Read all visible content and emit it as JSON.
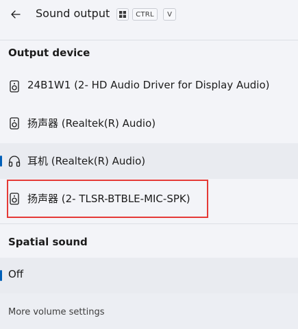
{
  "header": {
    "title": "Sound output",
    "shortcut": {
      "ctrl": "CTRL",
      "v": "V"
    }
  },
  "output_device": {
    "heading": "Output device",
    "items": [
      {
        "label": "24B1W1 (2- HD Audio Driver for Display Audio)",
        "icon": "speaker-icon",
        "selected": false
      },
      {
        "label": "扬声器 (Realtek(R) Audio)",
        "icon": "speaker-icon",
        "selected": false
      },
      {
        "label": "耳机 (Realtek(R) Audio)",
        "icon": "headphones-icon",
        "selected": true
      },
      {
        "label": "扬声器 (2- TLSR-BTBLE-MIC-SPK)",
        "icon": "speaker-icon",
        "selected": false,
        "highlighted": true
      }
    ]
  },
  "spatial_sound": {
    "heading": "Spatial sound",
    "items": [
      {
        "label": "Off",
        "selected": true
      }
    ]
  },
  "footer": {
    "link": "More volume settings"
  },
  "colors": {
    "accent": "#005fb8",
    "highlight": "#e53935"
  }
}
